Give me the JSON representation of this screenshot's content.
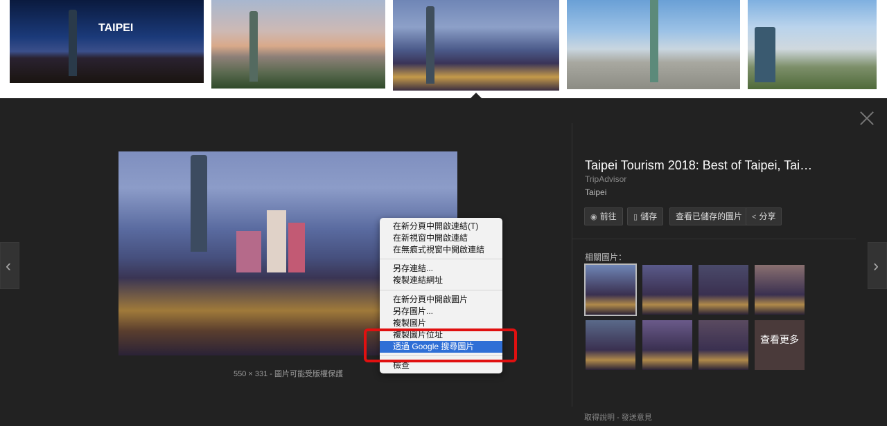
{
  "strip": {
    "thumbs": [
      {
        "label": "TAIPEI"
      },
      {
        "label": ""
      },
      {
        "label": ""
      },
      {
        "label": ""
      },
      {
        "label": ""
      }
    ]
  },
  "viewer": {
    "title": "Taipei Tourism 2018: Best of Taipei, Tai…",
    "source": "TripAdvisor",
    "description": "Taipei",
    "caption": "550 × 331 - 圖片可能受版權保護",
    "buttons": {
      "visit": "前往",
      "save": "儲存",
      "view_saved": "查看已儲存的圖片",
      "share": "分享"
    },
    "related_label": "相關圖片：",
    "see_more": "查看更多",
    "footer": "取得說明 - 發送意見",
    "related_colors": [
      "#6f86b6",
      "#5a5a8a",
      "#4a4a6a",
      "#8a7070",
      "#5a6a8a",
      "#6a5a8a",
      "#5a4a60",
      "#4a3a3a"
    ]
  },
  "context_menu": {
    "items": [
      "在新分頁中開啟連結(T)",
      "在新視窗中開啟連結",
      "在無痕式視窗中開啟連結",
      "另存連結...",
      "複製連結網址",
      "在新分頁中開啟圖片",
      "另存圖片...",
      "複製圖片",
      "複製圖片位址",
      "透過 Google 搜尋圖片",
      "檢查"
    ],
    "highlighted_index": 9
  },
  "colors": {
    "highlight": "#2f6fd6",
    "annotation_box": "#e01010",
    "panel_bg": "#222222"
  }
}
